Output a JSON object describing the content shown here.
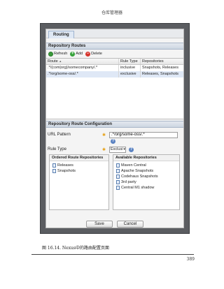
{
  "page": {
    "running_head": "仓库管理器",
    "caption": "图 16.14.   Nexus中的路由配置页面",
    "page_number": "389"
  },
  "colors": {
    "section_header": "#cdd6e2",
    "selected_row": "#dfe8f6",
    "required_marker": "#e6a21a",
    "help_icon": "#5b83c2",
    "frame": "#5b5d61"
  },
  "app": {
    "tab_label": "Routing",
    "routes_section_title": "Repository Routes",
    "toolbar": {
      "refresh_label": "Refresh",
      "add_label": "Add",
      "delete_label": "Delete",
      "refresh_icon": "refresh-icon",
      "add_icon": "add-icon",
      "delete_icon": "delete-icon"
    },
    "table": {
      "headers": [
        "Route",
        "Rule Type",
        "Repositories"
      ],
      "sort_indicator": "▲",
      "rows": [
        {
          "route": ".*/(com|org)/somecompany/.*",
          "rule_type": "inclusive",
          "repositories": "Snapshots, Releases",
          "selected": false
        },
        {
          "route": ".*/org/some-oss/.*",
          "rule_type": "exclusive",
          "repositories": "Releases, Snapshots",
          "selected": true
        }
      ]
    },
    "config_section_title": "Repository Route Configuration",
    "form": {
      "url_pattern_label": "URL Pattern",
      "url_pattern_value": ".*/org/some-oss/.*",
      "rule_type_label": "Rule Type",
      "rule_type_value": "Exclusi",
      "required_marker": "✱",
      "help_glyph": "?"
    },
    "ordered_repos": {
      "title": "Ordered Route Repositories",
      "items": [
        "Releases",
        "Snapshots"
      ]
    },
    "available_repos": {
      "title": "Available Repositories",
      "items": [
        "Maven Central",
        "Apache Snapshots",
        "Codehaus Snapshots",
        "3rd party",
        "Central M1 shadow"
      ]
    },
    "buttons": {
      "save_label": "Save",
      "cancel_label": "Cancel"
    }
  }
}
